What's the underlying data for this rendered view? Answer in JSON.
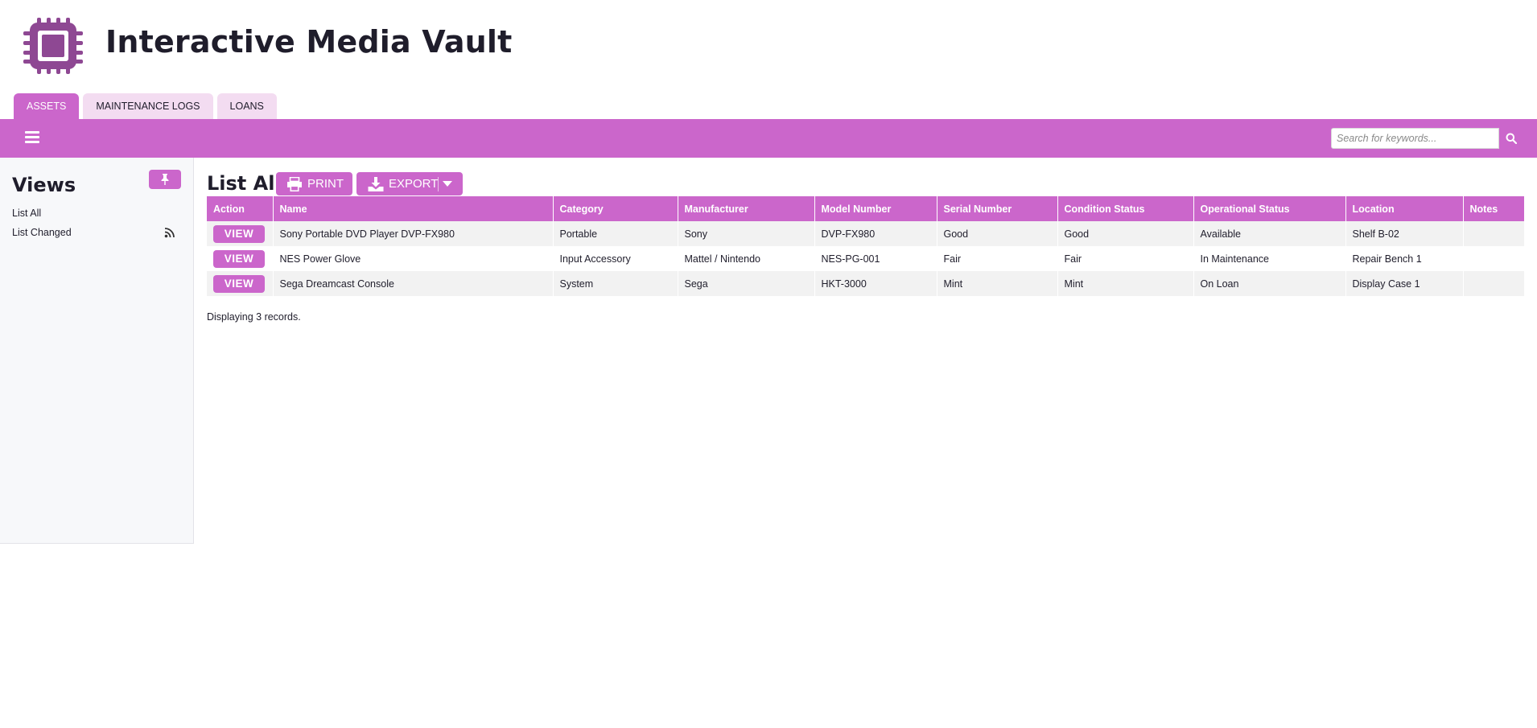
{
  "header": {
    "title": "Interactive Media Vault",
    "logo_icon": "chip-icon"
  },
  "tabs": [
    {
      "label": "ASSETS",
      "active": true
    },
    {
      "label": "MAINTENANCE LOGS",
      "active": false
    },
    {
      "label": "LOANS",
      "active": false
    }
  ],
  "toolbar": {
    "menu_icon": "hamburger-icon",
    "search_placeholder": "Search for keywords...",
    "search_icon": "search-icon"
  },
  "sidebar": {
    "title": "Views",
    "pin_icon": "pin-icon",
    "items": [
      {
        "label": "List All"
      },
      {
        "label": "List Changed",
        "icon": "rss-icon"
      }
    ]
  },
  "main": {
    "title": "List All",
    "print_label": "PRINT",
    "export_label": "EXPORT",
    "print_icon": "printer-icon",
    "export_icon": "download-icon",
    "footer": "Displaying 3 records."
  },
  "table": {
    "columns": [
      "Action",
      "Name",
      "Category",
      "Manufacturer",
      "Model Number",
      "Serial Number",
      "Condition Status",
      "Operational Status",
      "Location",
      "Notes"
    ],
    "rows": [
      {
        "action": "VIEW",
        "name": "Sony Portable DVD Player DVP-FX980",
        "category": "Portable",
        "manufacturer": "Sony",
        "model": "DVP-FX980",
        "serial": "Good",
        "condition": "Good",
        "operational": "Available",
        "location": "Shelf B-02",
        "notes": ""
      },
      {
        "action": "VIEW",
        "name": "NES Power Glove",
        "category": "Input Accessory",
        "manufacturer": "Mattel / Nintendo",
        "model": "NES-PG-001",
        "serial": "Fair",
        "condition": "Fair",
        "operational": "In Maintenance",
        "location": "Repair Bench 1",
        "notes": ""
      },
      {
        "action": "VIEW",
        "name": "Sega Dreamcast Console",
        "category": "System",
        "manufacturer": "Sega",
        "model": "HKT-3000",
        "serial": "Mint",
        "condition": "Mint",
        "operational": "On Loan",
        "location": "Display Case 1",
        "notes": ""
      }
    ]
  },
  "colors": {
    "accent": "#cb66cb",
    "logo": "#8e4893",
    "tab_inactive": "#f3dcf1"
  }
}
